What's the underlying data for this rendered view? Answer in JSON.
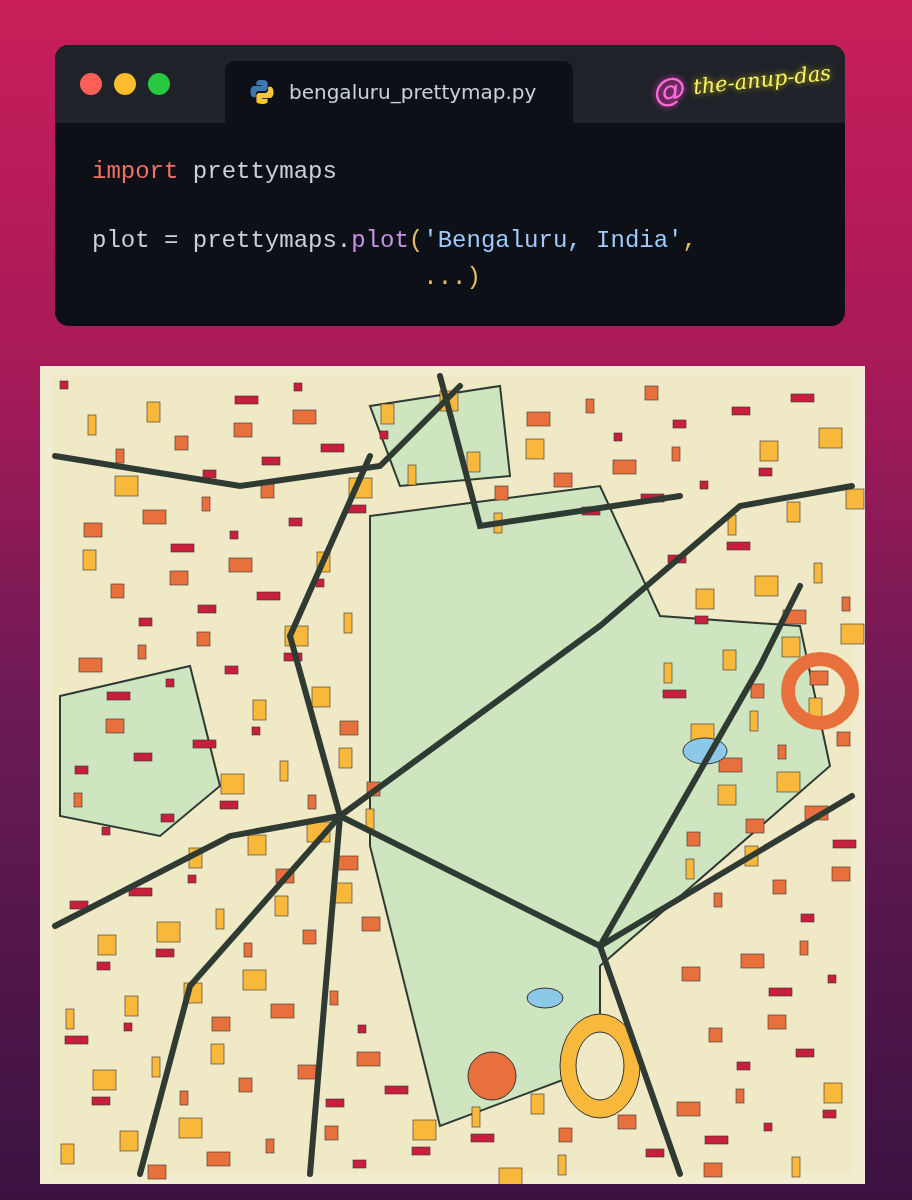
{
  "window": {
    "traffic_lights": [
      {
        "color": "#ff5f57"
      },
      {
        "color": "#febc2e"
      },
      {
        "color": "#28c840"
      }
    ],
    "tabs": [
      {
        "label": "bengaluru_prettymap.py",
        "selected": true
      }
    ],
    "handle": {
      "at": "@",
      "name": "the-anup-das"
    }
  },
  "code_blocks": [
    [
      [
        {
          "kind": "keyword",
          "text": "import"
        },
        {
          "kind": "plain",
          "text": " prettymaps"
        }
      ]
    ],
    [
      [
        {
          "kind": "plain",
          "text": "plot = prettymaps."
        },
        {
          "kind": "function",
          "text": "plot"
        },
        {
          "kind": "punct",
          "text": "("
        },
        {
          "kind": "string",
          "text": "'Bengaluru, India'"
        },
        {
          "kind": "punct",
          "text": ","
        }
      ],
      [
        {
          "kind": "punct",
          "text": "                       ...)"
        }
      ]
    ]
  ]
}
